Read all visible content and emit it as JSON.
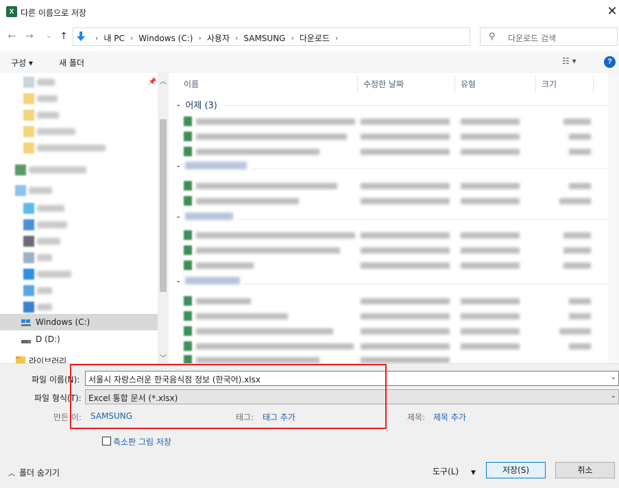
{
  "window": {
    "title": "다른 이름으로 저장",
    "icon": "excel-icon",
    "close": "✕"
  },
  "address": {
    "crumbs": [
      "내 PC",
      "Windows (C:)",
      "사용자",
      "SAMSUNG",
      "다운로드"
    ],
    "search_placeholder": "다운로드 검색"
  },
  "toolbar": {
    "organize": "구성 ▾",
    "new_folder": "새 폴더",
    "help": "?"
  },
  "nav": {
    "selected_drive": "Windows (C:)",
    "drive_d": "D (D:)",
    "libraries": "라이브러리"
  },
  "columns": [
    "이름",
    "수정한 날짜",
    "유형",
    "크기"
  ],
  "groups": [
    {
      "label": "어제 (3)"
    }
  ],
  "save": {
    "filename_label": "파일 이름(N):",
    "filename_value": "서울시 자랑스러운 한국음식점 정보 (한국어).xlsx",
    "filetype_label": "파일 형식(T):",
    "filetype_value": "Excel 통합 문서 (*.xlsx)",
    "author_label": "만든 이:",
    "author_value": "SAMSUNG",
    "tags_label": "태그:",
    "tags_value": "태그 추가",
    "title_label": "제목:",
    "title_value": "제목 추가",
    "thumbnail_label": "축소판 그림 저장"
  },
  "footer": {
    "hide_folders": "폴더 숨기기",
    "tools": "도구(L)",
    "save_button": "저장(S)",
    "cancel_button": "취소"
  },
  "colors": {
    "accent": "#0078d7",
    "highlight": "#e81c1c",
    "link": "#1a5fb4"
  }
}
